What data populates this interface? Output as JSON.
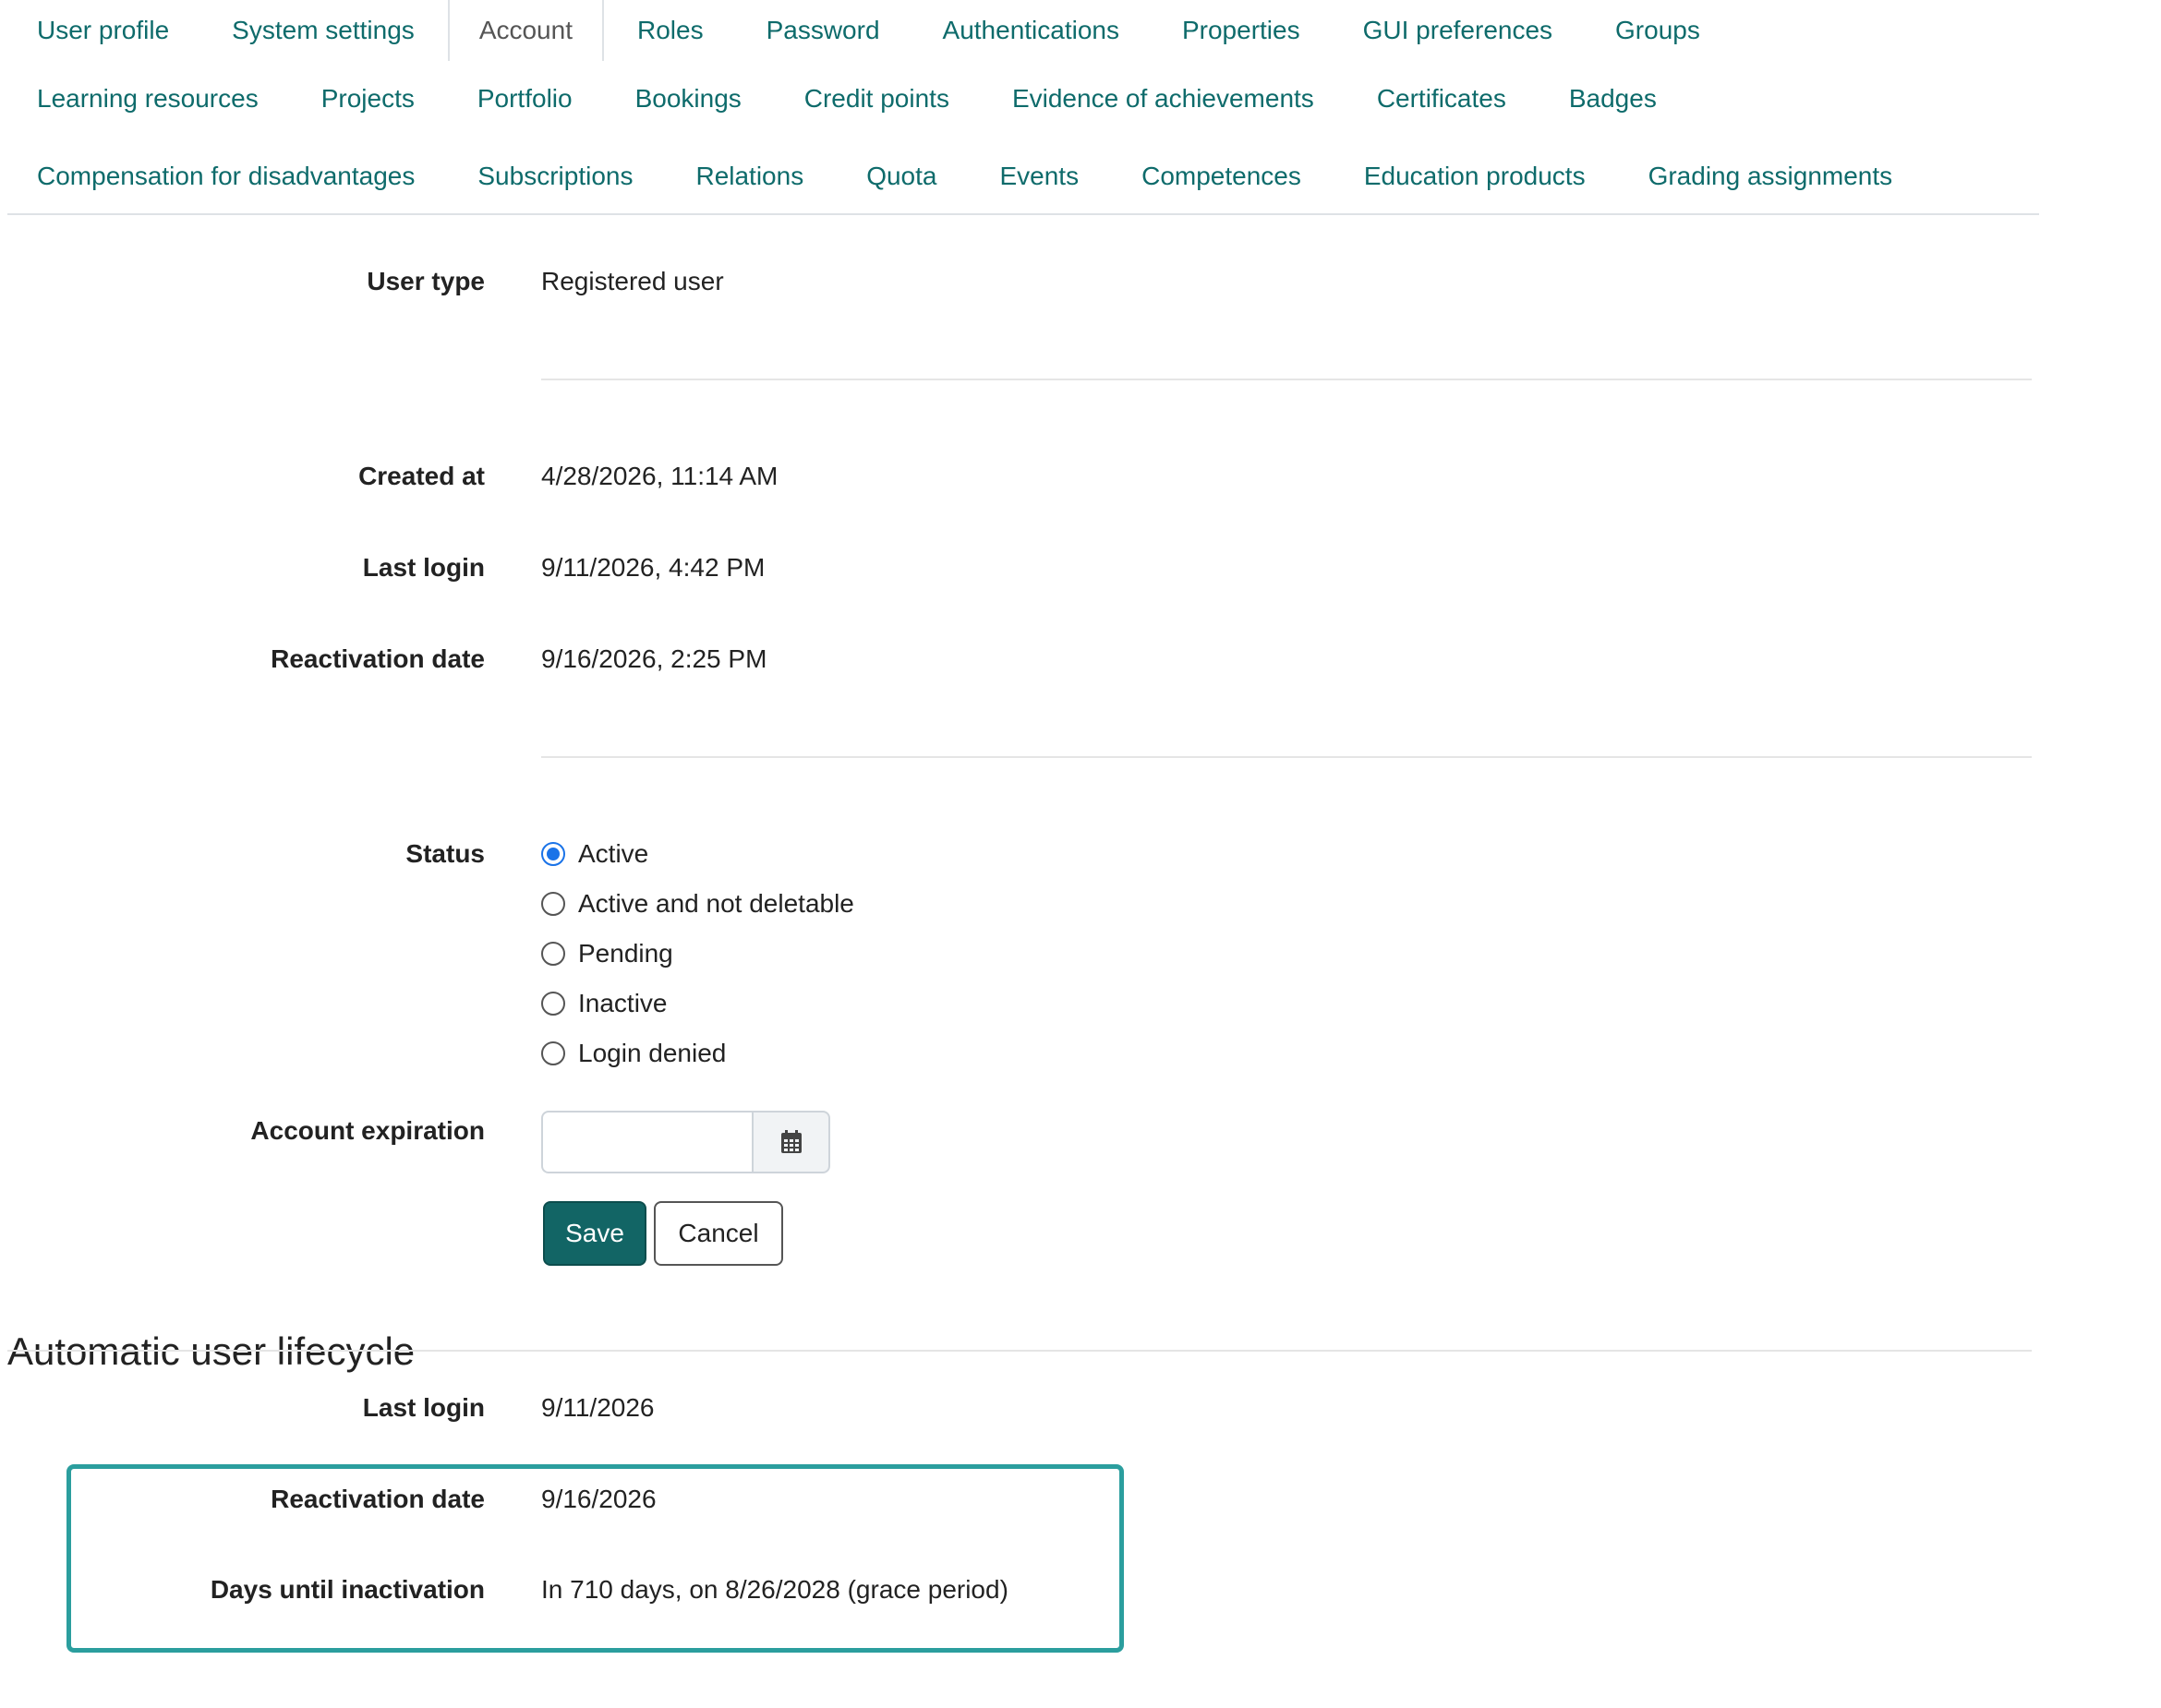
{
  "tabs": {
    "row1": [
      "User profile",
      "System settings",
      "Account",
      "Roles",
      "Password",
      "Authentications",
      "Properties",
      "GUI preferences",
      "Groups"
    ],
    "row2": [
      "Learning resources",
      "Projects",
      "Portfolio",
      "Bookings",
      "Credit points",
      "Evidence of achievements",
      "Certificates",
      "Badges"
    ],
    "row3": [
      "Compensation for disadvantages",
      "Subscriptions",
      "Relations",
      "Quota",
      "Events",
      "Competences",
      "Education products",
      "Grading assignments"
    ],
    "active": "Account"
  },
  "account": {
    "user_type_label": "User type",
    "user_type_value": "Registered user",
    "created_label": "Created at",
    "created_value": "4/28/2026, 11:14 AM",
    "last_login_label": "Last login",
    "last_login_value": "9/11/2026, 4:42 PM",
    "reactivation_label": "Reactivation date",
    "reactivation_value": "9/16/2026, 2:25 PM",
    "status_label": "Status",
    "status_options": [
      "Active",
      "Active and not deletable",
      "Pending",
      "Inactive",
      "Login denied"
    ],
    "status_selected": "Active",
    "expiration_label": "Account expiration",
    "expiration_value": "",
    "calendar_icon": "calendar-icon",
    "save_label": "Save",
    "cancel_label": "Cancel"
  },
  "lifecycle": {
    "title": "Automatic user lifecycle",
    "last_login_label": "Last login",
    "last_login_value": "9/11/2026",
    "reactivation_label": "Reactivation date",
    "reactivation_value": "9/16/2026",
    "days_label": "Days until inactivation",
    "days_value": "In 710 days, on 8/26/2028 (grace period)"
  },
  "colors": {
    "link": "#0e6b6b",
    "primary_button": "#126565",
    "highlight_border": "#2b9e9e",
    "radio_checked": "#1a73e8"
  }
}
